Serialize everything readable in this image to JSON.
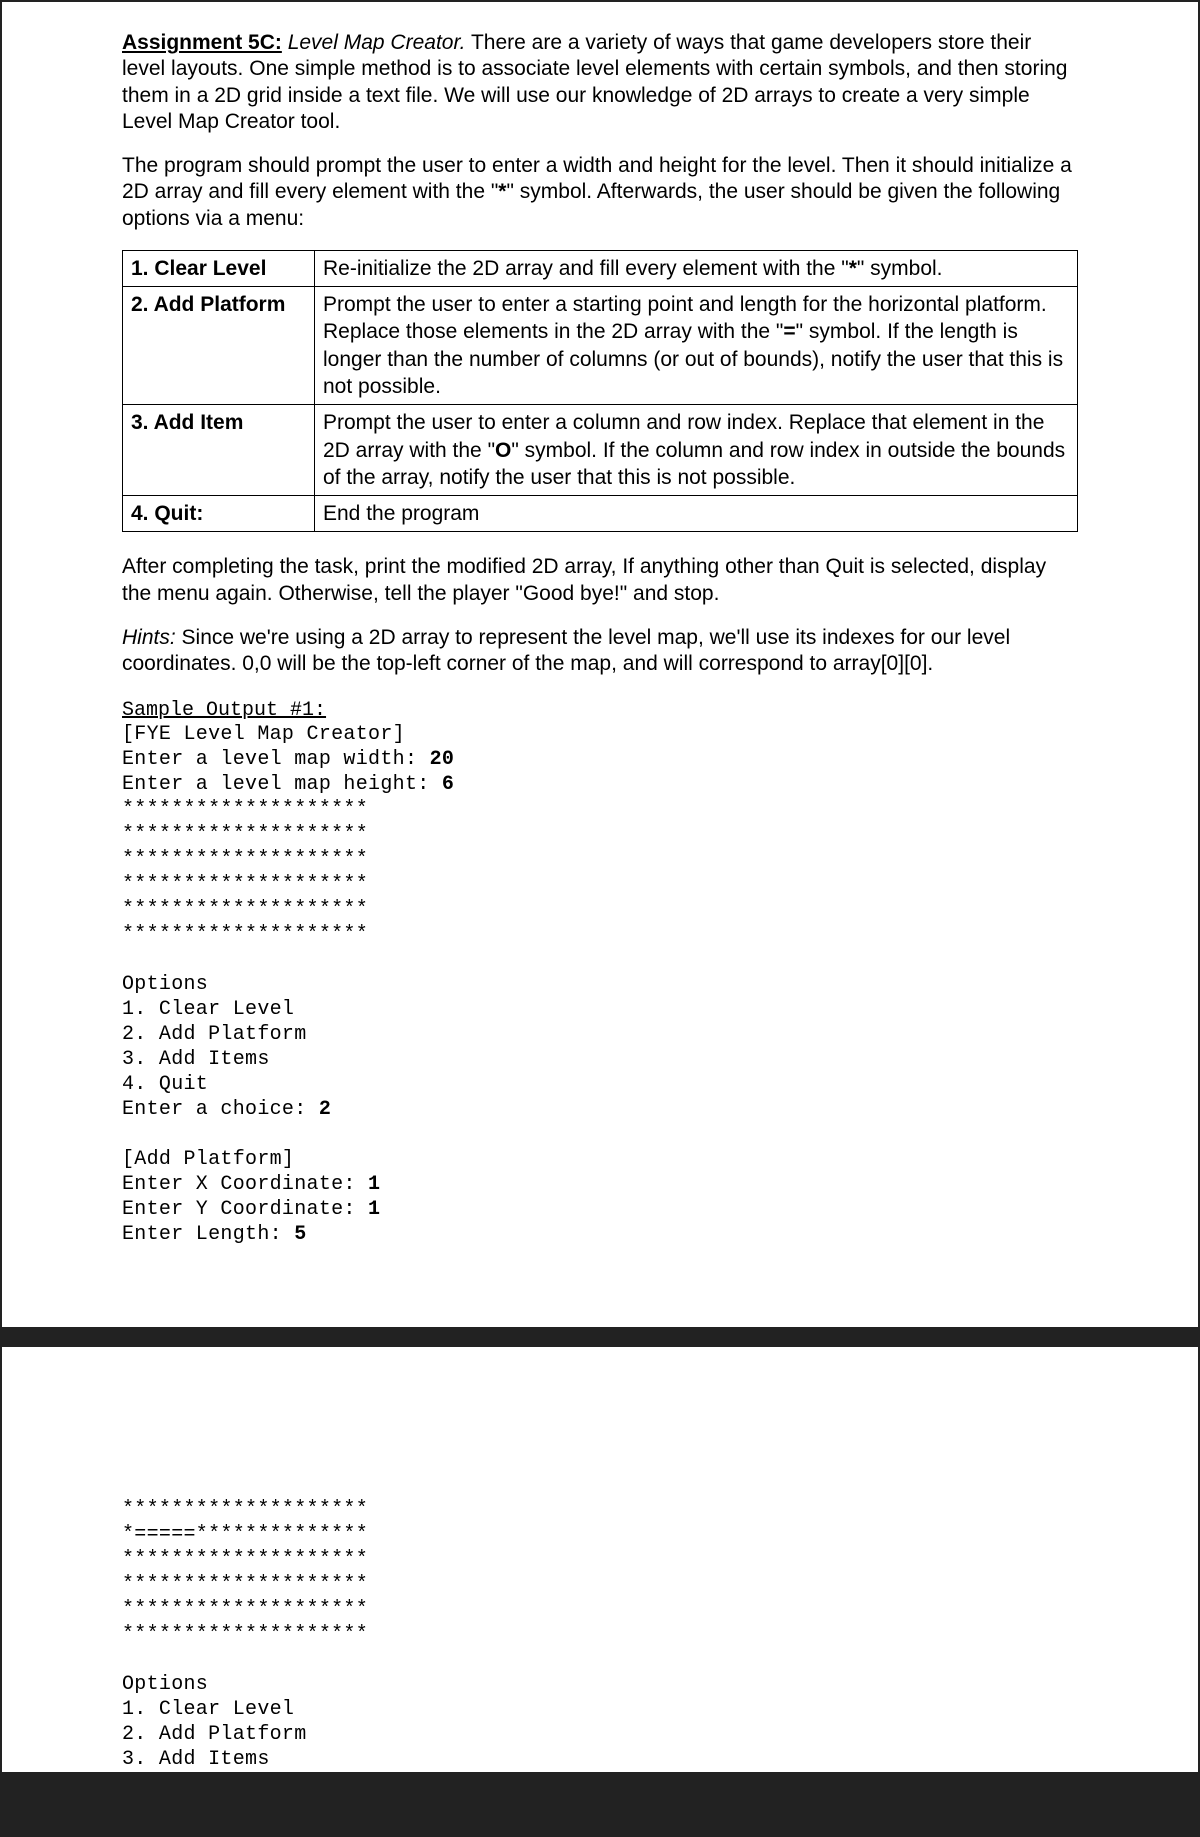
{
  "assignment": {
    "label": "Assignment 5C:",
    "title": "Level Map Creator.",
    "intro": " There are a variety of ways that game developers store their level layouts. One simple method is to associate level elements with certain symbols, and then storing them in a 2D grid inside a text file. We will use our knowledge of 2D arrays to create a very simple Level Map Creator tool."
  },
  "para2_a": "The program should prompt the user to enter a width and height for the level. Then it should initialize a 2D array and fill every element with the \"",
  "para2_sym": "*",
  "para2_b": "\" symbol. Afterwards, the user should be given the following options via a menu:",
  "options": [
    {
      "name": "1. Clear Level",
      "desc_a": "Re-initialize the 2D array and fill every element with the \"",
      "desc_sym": "*",
      "desc_b": "\" symbol."
    },
    {
      "name": "2. Add Platform",
      "desc_a": "Prompt the user to enter a starting point and length for the horizontal platform. Replace those elements in the 2D array with the \"",
      "desc_sym": "=",
      "desc_b": "\" symbol. If the length is longer than the number of columns (or out of bounds), notify the user that this is not possible."
    },
    {
      "name": "3. Add Item",
      "desc_a": "Prompt the user to enter a column and row index. Replace that element in the 2D array with the \"",
      "desc_sym": "O",
      "desc_b": "\" symbol. If the column and row index in outside the bounds of the array, notify the user that this is not possible."
    },
    {
      "name": "4. Quit:",
      "desc_a": "End the program",
      "desc_sym": "",
      "desc_b": ""
    }
  ],
  "after_para": "After completing the task, print the modified 2D array, If anything other than Quit is selected, display the menu again. Otherwise, tell the player \"Good bye!\" and stop.",
  "hints_label": "Hints:",
  "hints_text": " Since we're using a 2D array to represent the level map, we'll use its indexes for our level coordinates. 0,0 will be the top-left corner of the map, and will correspond to array[0][0].",
  "sample_heading": "Sample Output #1:",
  "sample1": {
    "l01": "[FYE Level Map Creator]",
    "l02a": "Enter a level map width: ",
    "l02b": "20",
    "l03a": "Enter a level map height: ",
    "l03b": "6",
    "l04": "********************",
    "l05": "********************",
    "l06": "********************",
    "l07": "********************",
    "l08": "********************",
    "l09": "********************",
    "l10": "",
    "l11": "Options",
    "l12": "1. Clear Level",
    "l13": "2. Add Platform",
    "l14": "3. Add Items",
    "l15": "4. Quit",
    "l16a": "Enter a choice: ",
    "l16b": "2",
    "l17": "",
    "l18": "[Add Platform]",
    "l19a": "Enter X Coordinate: ",
    "l19b": "1",
    "l20a": "Enter Y Coordinate: ",
    "l20b": "1",
    "l21a": "Enter Length: ",
    "l21b": "5"
  },
  "sample2": {
    "l01": "********************",
    "l02": "*=====**************",
    "l03": "********************",
    "l04": "********************",
    "l05": "********************",
    "l06": "********************",
    "l07": "",
    "l08": "Options",
    "l09": "1. Clear Level",
    "l10": "2. Add Platform",
    "l11": "3. Add Items"
  }
}
